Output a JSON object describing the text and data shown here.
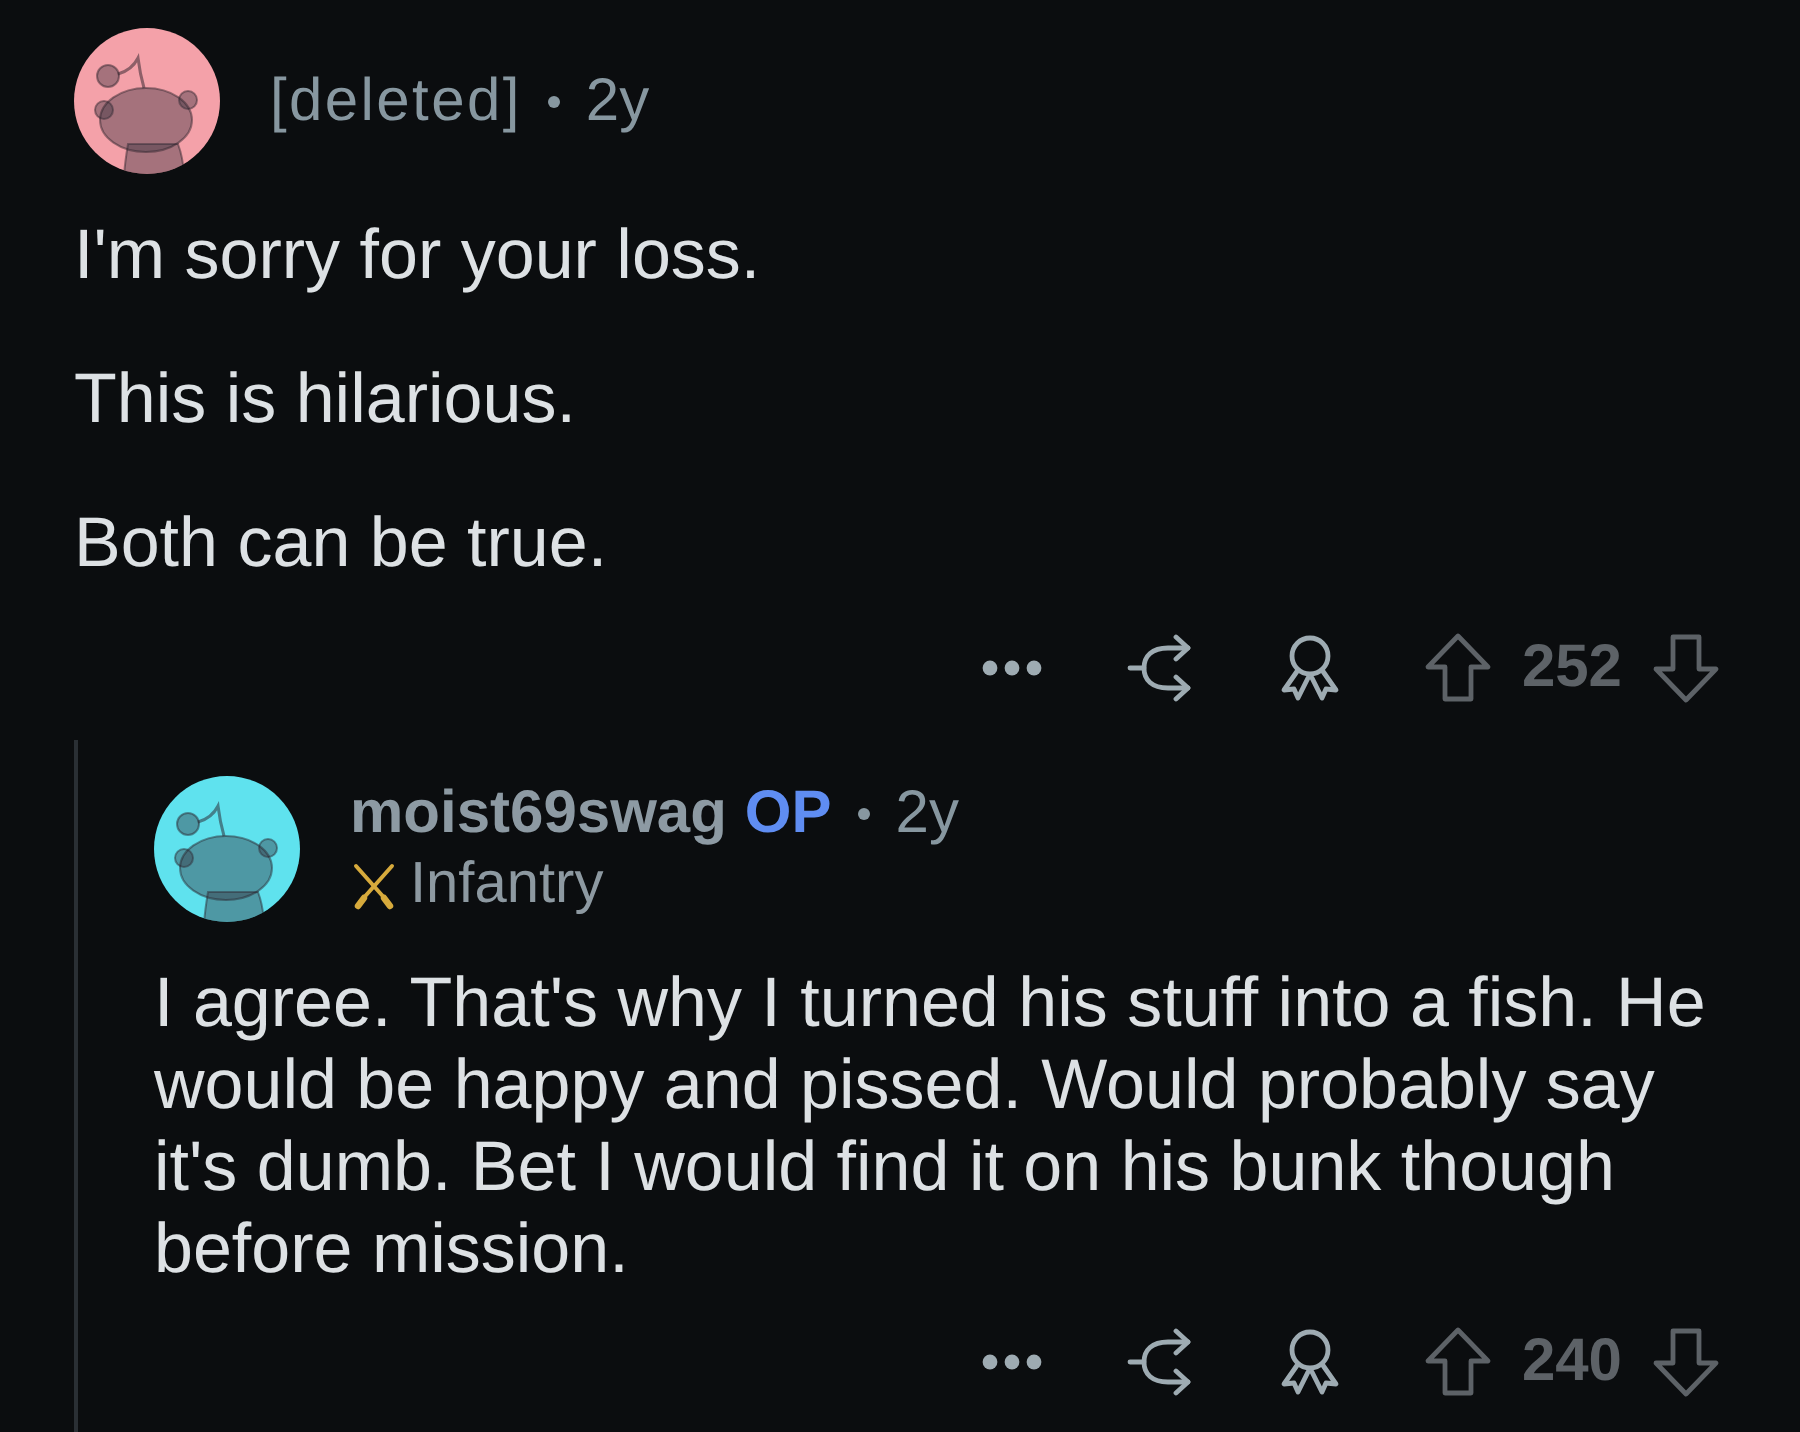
{
  "comments": [
    {
      "author": "[deleted]",
      "deleted": true,
      "color": "#f4a1a9",
      "time": "2y",
      "paragraphs": [
        "I'm sorry for your loss.",
        "This is hilarious.",
        "Both can be true."
      ],
      "score": "252",
      "replies": [
        {
          "author": "moist69swag",
          "deleted": false,
          "badge": "OP",
          "color": "#5fe2ee",
          "time": "2y",
          "flair": "Infantry",
          "paragraphs": [
            "I agree. That's why I turned his stuff into a fish. He would be happy and pissed. Would probably say it's dumb. Bet I would find it on his bunk though before mission."
          ],
          "score": "240"
        }
      ]
    }
  ]
}
